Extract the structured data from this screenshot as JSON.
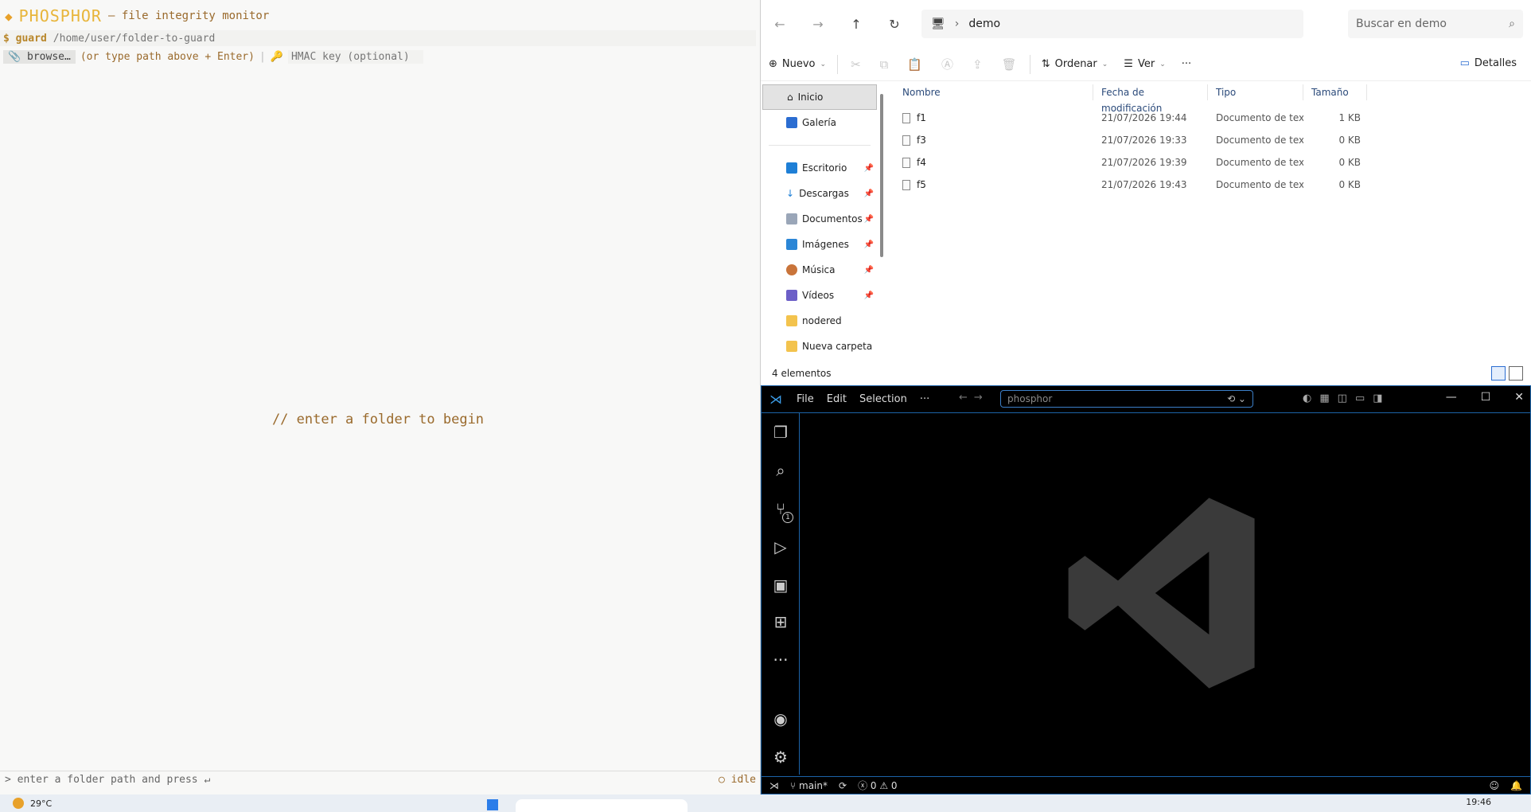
{
  "phosphor": {
    "brand": "PHOSPHOR",
    "subtitle": "— file integrity monitor",
    "prompt": "$ guard",
    "path_placeholder": "/home/user/folder-to-guard",
    "browse_label": "browse…",
    "browse_hint": "(or type path above + Enter)",
    "hmac_placeholder": "HMAC key (optional)",
    "empty_message": "// enter a folder to begin",
    "status_message": "> enter a folder path and press ↵",
    "status_state": "○ idle"
  },
  "explorer": {
    "address": "demo",
    "search_placeholder": "Buscar en demo",
    "toolbar": {
      "new": "Nuevo",
      "sort": "Ordenar",
      "view": "Ver",
      "more": "···",
      "details": "Detalles"
    },
    "sidebar_top": [
      {
        "label": "Inicio",
        "icon": "home-icon"
      },
      {
        "label": "Galería",
        "icon": "gallery-icon"
      }
    ],
    "sidebar_pinned": [
      {
        "label": "Escritorio",
        "icon": "desktop-icon"
      },
      {
        "label": "Descargas",
        "icon": "download-icon"
      },
      {
        "label": "Documentos",
        "icon": "documents-icon"
      },
      {
        "label": "Imágenes",
        "icon": "images-icon"
      },
      {
        "label": "Música",
        "icon": "music-icon"
      },
      {
        "label": "Vídeos",
        "icon": "videos-icon"
      }
    ],
    "sidebar_folders": [
      "nodered",
      "Nueva carpeta"
    ],
    "columns": [
      "Nombre",
      "Fecha de modificación",
      "Tipo",
      "Tamaño"
    ],
    "files": [
      {
        "name": "f1",
        "modified": "21/07/2026 19:44",
        "type": "Documento de tex...",
        "size": "1 KB"
      },
      {
        "name": "f3",
        "modified": "21/07/2026 19:33",
        "type": "Documento de tex...",
        "size": "0 KB"
      },
      {
        "name": "f4",
        "modified": "21/07/2026 19:39",
        "type": "Documento de tex...",
        "size": "0 KB"
      },
      {
        "name": "f5",
        "modified": "21/07/2026 19:43",
        "type": "Documento de tex...",
        "size": "0 KB"
      }
    ],
    "item_count": "4 elementos"
  },
  "vscode": {
    "menu": [
      "File",
      "Edit",
      "Selection",
      "···"
    ],
    "command_center": "phosphor",
    "scm_badge": "1",
    "branch": "main*",
    "errors": "0",
    "warnings": "0"
  },
  "taskbar": {
    "temperature": "29°C",
    "time": "19:46"
  },
  "colors": {
    "phosphor_accent": "#e8b53a",
    "phosphor_text": "#9a6a2c",
    "vscode_border": "#1c63a8"
  }
}
